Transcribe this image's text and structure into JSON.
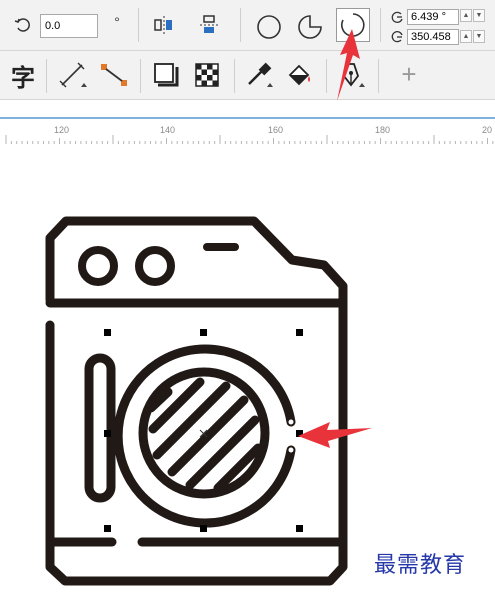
{
  "toolbar": {
    "rotation_value": "0.0",
    "degree_symbol": "°",
    "start_angle": "6.439 °",
    "end_angle": "350.458",
    "plus_label": "+"
  },
  "icons": {
    "text_glyph": "字"
  },
  "ruler": {
    "labels": [
      "120",
      "140",
      "160",
      "180",
      "20"
    ]
  },
  "watermark": {
    "text": "最需教育"
  },
  "colors": {
    "accent_red": "#e8333b",
    "drawing_stroke": "#211916",
    "watermark_blue": "#2638a8"
  }
}
